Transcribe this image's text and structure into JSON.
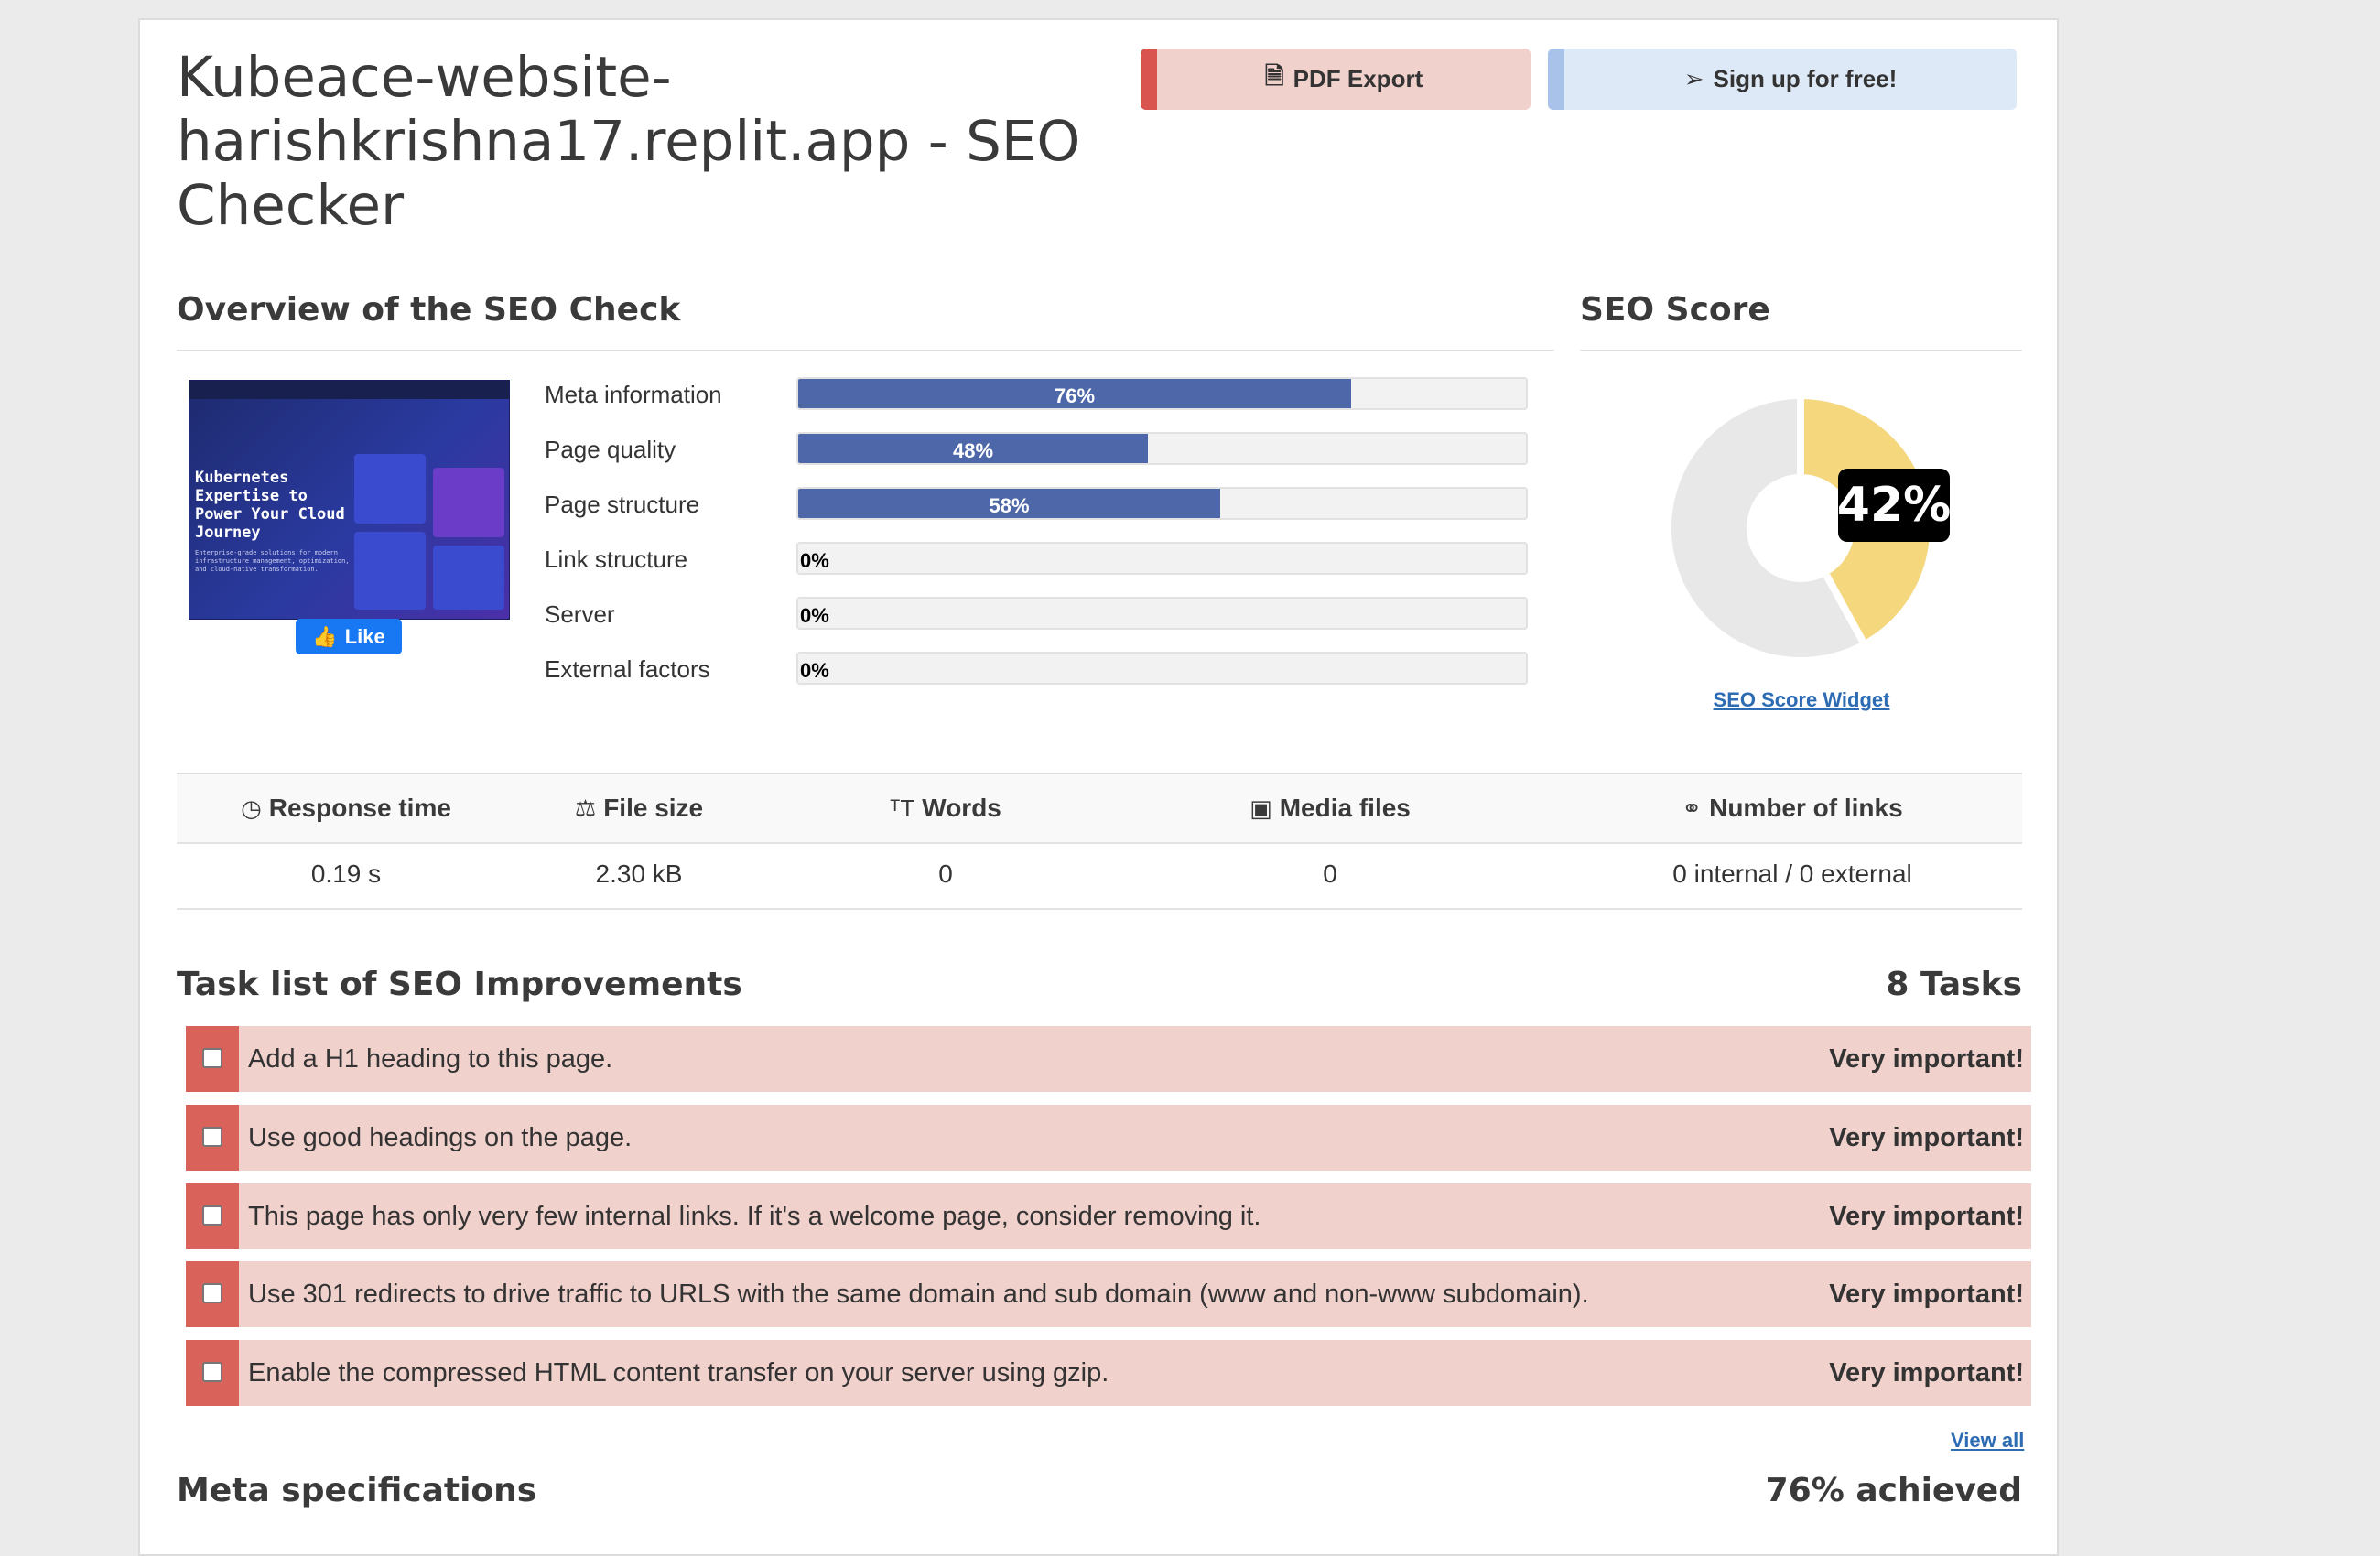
{
  "page": {
    "title": "Kubeace-website-harishkrishna17.replit.app - SEO Checker"
  },
  "actions": {
    "pdf_export": "PDF Export",
    "signup": "Sign up for free!"
  },
  "overview": {
    "heading": "Overview of the SEO Check",
    "like_label": "Like",
    "thumbnail": {
      "headline": "Kubernetes Expertise to Power Your Cloud Journey",
      "subtext": "Enterprise-grade solutions for modern infrastructure management, optimization, and cloud-native transformation."
    },
    "metrics": [
      {
        "label": "Meta information",
        "percent": 76,
        "text": "76%"
      },
      {
        "label": "Page quality",
        "percent": 48,
        "text": "48%"
      },
      {
        "label": "Page structure",
        "percent": 58,
        "text": "58%"
      },
      {
        "label": "Link structure",
        "percent": 0,
        "text": "0%"
      },
      {
        "label": "Server",
        "percent": 0,
        "text": "0%"
      },
      {
        "label": "External factors",
        "percent": 0,
        "text": "0%"
      }
    ]
  },
  "score": {
    "heading": "SEO Score",
    "value": 42,
    "text": "42%",
    "widget_link": "SEO Score Widget",
    "colors": {
      "fill": "#f5d77e",
      "rest": "#e8e8e8"
    }
  },
  "stats": {
    "headers": [
      {
        "label": "Response time",
        "icon": "clock-icon"
      },
      {
        "label": "File size",
        "icon": "scale-icon"
      },
      {
        "label": "Words",
        "icon": "text-size-icon"
      },
      {
        "label": "Media files",
        "icon": "image-icon"
      },
      {
        "label": "Number of links",
        "icon": "link-icon"
      }
    ],
    "values": [
      "0.19 s",
      "2.30 kB",
      "0",
      "0",
      "0 internal / 0 external"
    ]
  },
  "tasks": {
    "heading": "Task list of SEO Improvements",
    "count": "8 Tasks",
    "items": [
      {
        "text": "Add a H1 heading to this page.",
        "importance": "Very important!"
      },
      {
        "text": "Use good headings on the page.",
        "importance": "Very important!"
      },
      {
        "text": "This page has only very few internal links. If it's a welcome page, consider removing it.",
        "importance": "Very important!"
      },
      {
        "text": "Use 301 redirects to drive traffic to URLS with the same domain and sub domain (www and non-www subdomain).",
        "importance": "Very important!"
      },
      {
        "text": "Enable the compressed HTML content transfer on your server using gzip.",
        "importance": "Very important!"
      }
    ],
    "view_all": "View all"
  },
  "meta_spec": {
    "heading": "Meta specifications",
    "achieved": "76% achieved"
  },
  "colors": {
    "bar": "#4e67a8",
    "danger": "#d9625a",
    "danger_bg": "#f1d1cc",
    "info_bg": "#dde9f6",
    "link": "#2d6bb3"
  }
}
